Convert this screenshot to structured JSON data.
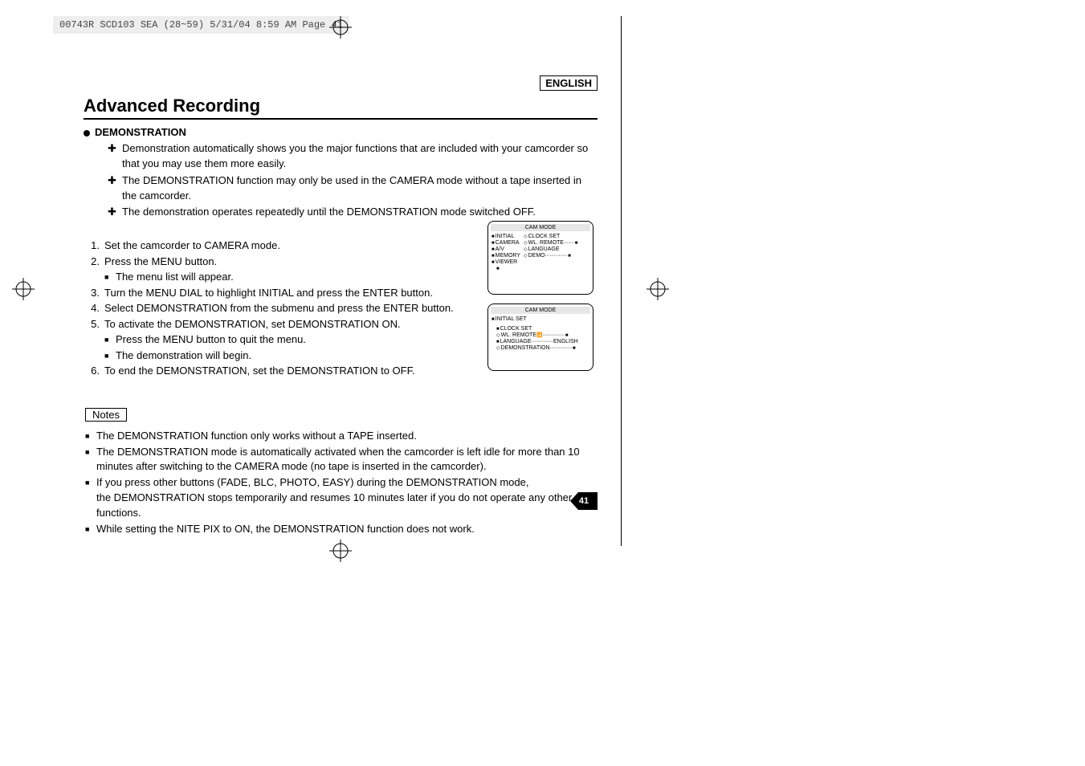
{
  "print_slug": "00743R SCD103 SEA (28~59)  5/31/04 8:59 AM  Page 41",
  "lang": "ENGLISH",
  "title": "Advanced Recording",
  "section_head": "DEMONSTRATION",
  "plus": [
    "Demonstration automatically shows you the major functions that are included with your camcorder so that you may use them more easily.",
    "The DEMONSTRATION function may only be used in the CAMERA mode without a tape inserted in the camcorder.",
    "The demonstration operates repeatedly until the DEMONSTRATION mode switched OFF."
  ],
  "steps": {
    "s1": "Set the camcorder to CAMERA mode.",
    "s2": "Press the MENU button.",
    "s2a": "The menu list will appear.",
    "s3": "Turn the MENU DIAL to highlight INITIAL and press the ENTER button.",
    "s4": "Select DEMONSTRATION from the submenu and press the ENTER button.",
    "s5": "To activate the DEMONSTRATION, set DEMONSTRATION ON.",
    "s5a": "Press the MENU button to quit the menu.",
    "s5b": "The demonstration will begin.",
    "s6": "To end the DEMONSTRATION, set the DEMONSTRATION to OFF."
  },
  "notes_label": "Notes",
  "notes": {
    "n1": "The DEMONSTRATION function only works without a TAPE inserted.",
    "n2": "The DEMONSTRATION mode is automatically activated when the camcorder is left idle for more than 10 minutes after switching to the CAMERA mode (no tape is inserted in the camcorder).",
    "n3a": "If you press other buttons (FADE, BLC, PHOTO, EASY) during the DEMONSTRATION mode,",
    "n3b": "the DEMONSTRATION stops temporarily and resumes 10 minutes later if you do not operate any other functions.",
    "n4": "While setting the NITE PIX to ON, the DEMONSTRATION function does not work."
  },
  "screen1": {
    "title": "CAM  MODE",
    "left": [
      "INITIAL",
      "CAMERA",
      "A/V",
      "MEMORY",
      "VIEWER"
    ],
    "right": [
      "CLOCK  SET",
      "WL. REMOTE",
      "LANGUAGE",
      "DEMO"
    ]
  },
  "screen2": {
    "title": "CAM  MODE",
    "sub": "INITIAL SET",
    "items": {
      "a": "CLOCK  SET",
      "b": "WL. REMOTE",
      "c": "LANGUAGE",
      "c_val": "ENGLISH",
      "d": "DEMONSTRATION"
    }
  },
  "page_number": "41"
}
